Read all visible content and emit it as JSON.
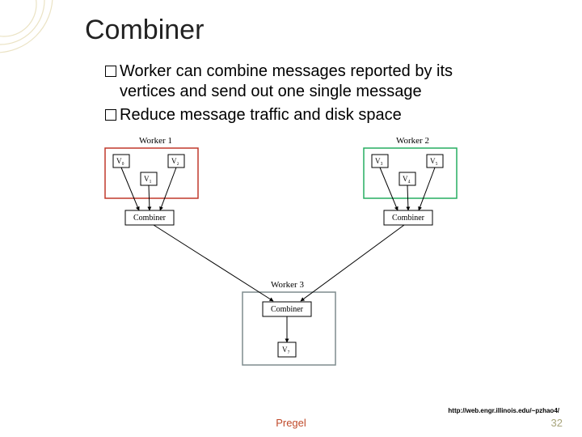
{
  "title": "Combiner",
  "bullets": [
    {
      "first": "Worker",
      "rest_line1": " can combine messages reported by its",
      "line2": "vertices and send out one single message"
    },
    {
      "first": "Reduce",
      "rest_line1": " message traffic and disk space",
      "line2": ""
    }
  ],
  "diagram": {
    "workers": {
      "w1": {
        "label": "Worker 1",
        "box_stroke": "#c0392b",
        "vertices": [
          "V₀",
          "V₁",
          "V₂"
        ],
        "combiner": "Combiner"
      },
      "w2": {
        "label": "Worker 2",
        "box_stroke": "#27ae60",
        "vertices": [
          "V₃",
          "V₄",
          "V₅"
        ],
        "combiner": "Combiner"
      },
      "w3": {
        "label": "Worker 3",
        "box_stroke": "#7f8c8d",
        "combiner": "Combiner",
        "out_vertex": "V₇"
      }
    }
  },
  "citation": "http://web.engr.illinois.edu/~pzhao4/",
  "footer": {
    "center": "Pregel",
    "number": "32"
  }
}
